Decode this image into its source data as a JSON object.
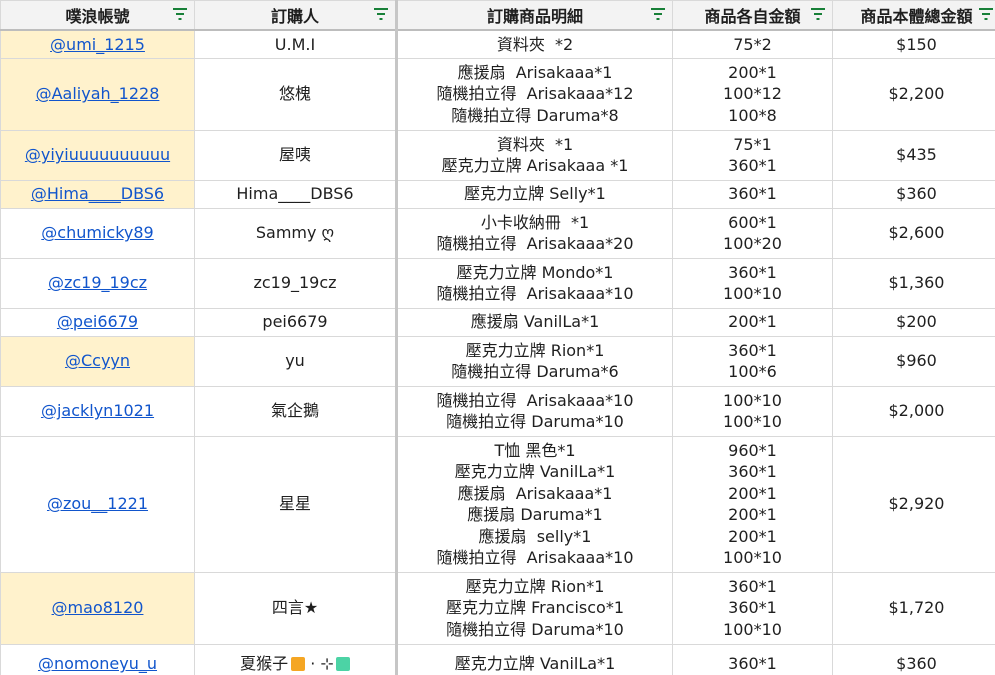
{
  "headers": [
    "噗浪帳號",
    "訂購人",
    "訂購商品明細",
    "商品各自金額",
    "商品本體總金額"
  ],
  "rows": [
    {
      "handle": "@umi_1215",
      "hl": true,
      "name": "U.M.I",
      "items": [
        "資料夾  *2"
      ],
      "prices": [
        "75*2"
      ],
      "total": "$150"
    },
    {
      "handle": "@Aaliyah_1228",
      "hl": true,
      "name": "悠槐",
      "items": [
        "應援扇  Arisakaaa*1",
        "隨機拍立得  Arisakaaa*12",
        "隨機拍立得 Daruma*8"
      ],
      "prices": [
        "200*1",
        "100*12",
        "100*8"
      ],
      "total": "$2,200"
    },
    {
      "handle": "@yiyiuuuuuuuuuu",
      "hl": true,
      "name": "屋咦",
      "items": [
        "資料夾  *1",
        "壓克力立牌 Arisakaaa *1"
      ],
      "prices": [
        "75*1",
        "360*1"
      ],
      "total": "$435"
    },
    {
      "handle": "@Hima____DBS6",
      "hl": true,
      "name": "Hima____DBS6",
      "items": [
        "壓克力立牌 Selly*1"
      ],
      "prices": [
        "360*1"
      ],
      "total": "$360"
    },
    {
      "handle": "@chumicky89",
      "hl": false,
      "name": "Sammy ღ",
      "items": [
        "小卡收納冊  *1",
        "隨機拍立得  Arisakaaa*20"
      ],
      "prices": [
        "600*1",
        "100*20"
      ],
      "total": "$2,600"
    },
    {
      "handle": "@zc19_19cz",
      "hl": false,
      "name": "zc19_19cz",
      "items": [
        "壓克力立牌 Mondo*1",
        "隨機拍立得  Arisakaaa*10"
      ],
      "prices": [
        "360*1",
        "100*10"
      ],
      "total": "$1,360"
    },
    {
      "handle": "@pei6679",
      "hl": false,
      "name": "pei6679",
      "items": [
        "應援扇 VanilLa*1"
      ],
      "prices": [
        "200*1"
      ],
      "total": "$200"
    },
    {
      "handle": "@Ccyyn",
      "hl": true,
      "name": "yu",
      "items": [
        "壓克力立牌 Rion*1",
        "隨機拍立得 Daruma*6"
      ],
      "prices": [
        "360*1",
        "100*6"
      ],
      "total": "$960"
    },
    {
      "handle": "@jacklyn1021",
      "hl": false,
      "name": "氣企鵝",
      "items": [
        "隨機拍立得  Arisakaaa*10",
        "隨機拍立得 Daruma*10"
      ],
      "prices": [
        "100*10",
        "100*10"
      ],
      "total": "$2,000"
    },
    {
      "handle": "@zou__1221",
      "hl": false,
      "name": "星星",
      "items": [
        "T恤 黑色*1",
        "壓克力立牌 VanilLa*1",
        "應援扇  Arisakaaa*1",
        "應援扇 Daruma*1",
        "應援扇  selly*1",
        "隨機拍立得  Arisakaaa*10"
      ],
      "prices": [
        "960*1",
        "360*1",
        "200*1",
        "200*1",
        "200*1",
        "100*10"
      ],
      "total": "$2,920"
    },
    {
      "handle": "@mao8120",
      "hl": true,
      "name": "四言★",
      "items": [
        "壓克力立牌 Rion*1",
        "壓克力立牌 Francisco*1",
        "隨機拍立得 Daruma*10"
      ],
      "prices": [
        "360*1",
        "360*1",
        "100*10"
      ],
      "total": "$1,720"
    },
    {
      "handle": "@nomoneyu_u",
      "hl": false,
      "name": "夏猴子",
      "items": [
        "壓克力立牌 VanilLa*1"
      ],
      "prices": [
        "360*1"
      ],
      "total": "$360"
    }
  ],
  "colors": {
    "highlight": "#fff2cc",
    "link": "#1155cc",
    "filter_icon": "#188038",
    "header_bg": "#f3f3f3"
  }
}
